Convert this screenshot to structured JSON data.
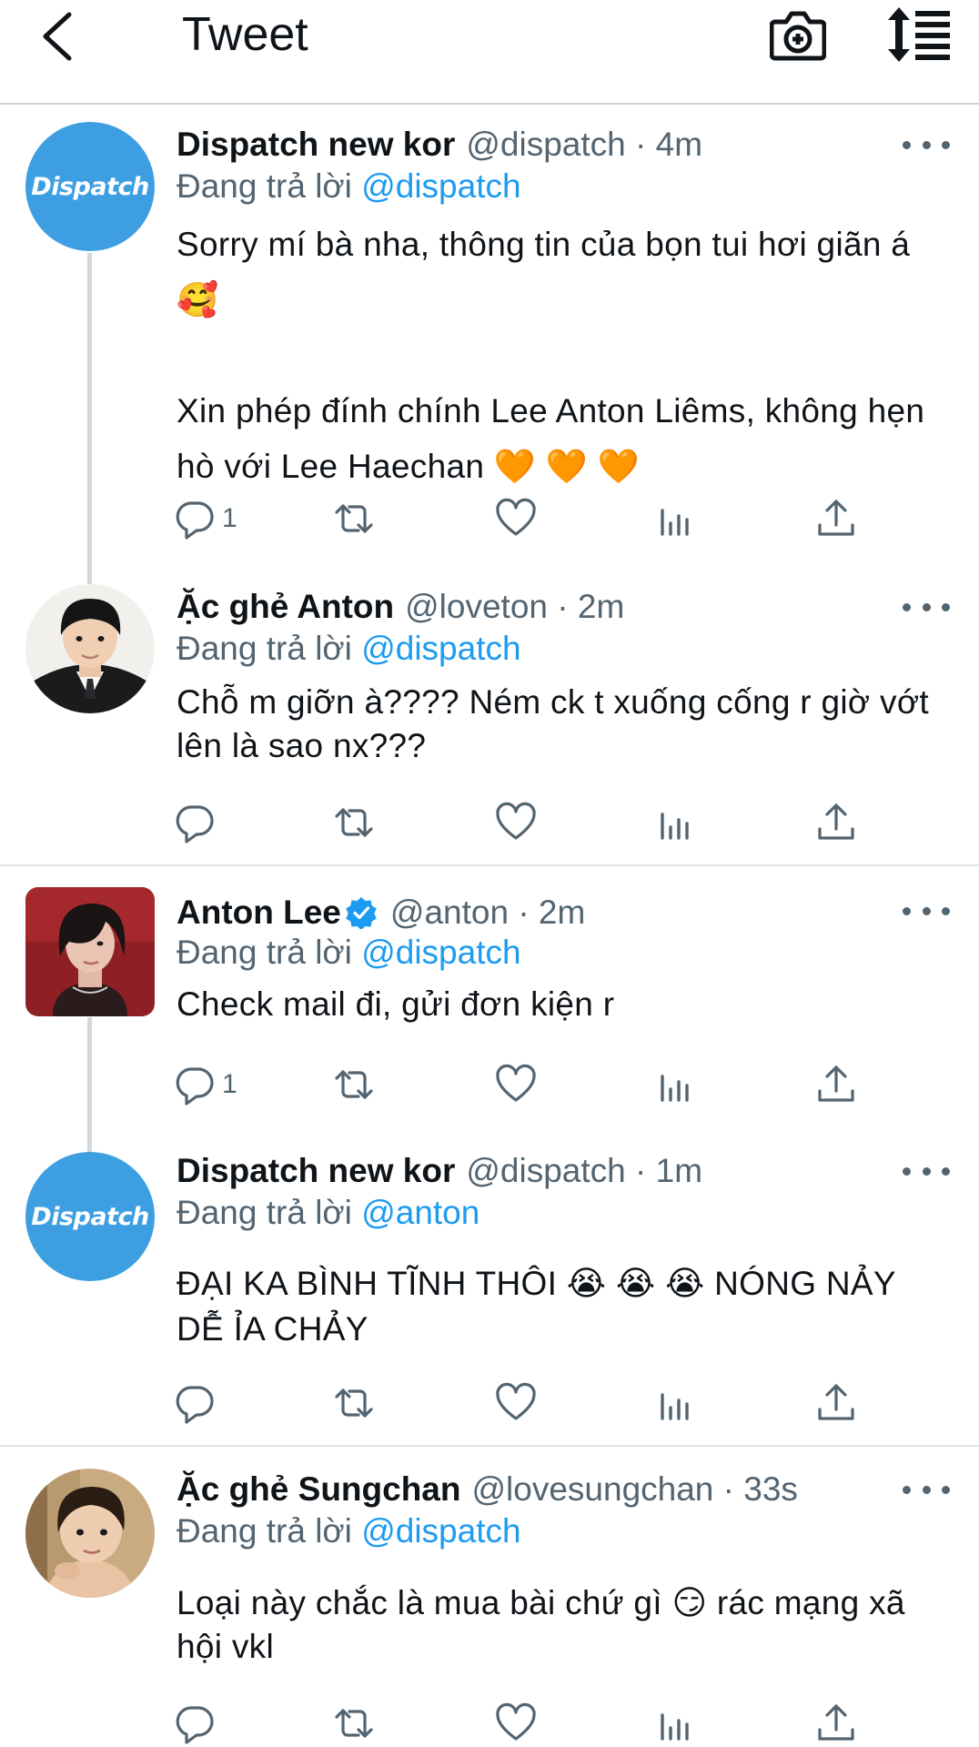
{
  "header": {
    "title": "Tweet"
  },
  "tweets": [
    {
      "name": "Dispatch new kor",
      "handle": "@dispatch · 4m",
      "avatar_text": "Dispatch",
      "reply_prefix": "Đang trả lời",
      "reply_to": "@dispatch",
      "text": "Sorry mí bà nha, thông tin của bọn tui hơi giãn á 🥰\n\nXin phép đính chính Lee Anton Liêms, không hẹn hò với Lee Haechan 🧡 🧡 🧡",
      "reply_count": "1"
    },
    {
      "name": "Ặc ghẻ Anton",
      "handle": "@loveton · 2m",
      "reply_prefix": "Đang trả lời",
      "reply_to": "@dispatch",
      "text": "Chỗ m giỡn à???? Ném ck t xuống cống r giờ vớt lên là sao nx???",
      "reply_count": ""
    },
    {
      "name": "Anton Lee",
      "handle": "@anton · 2m",
      "verified": true,
      "reply_prefix": "Đang trả lời",
      "reply_to": "@dispatch",
      "text": "Check mail đi, gửi đơn kiện r",
      "reply_count": "1"
    },
    {
      "name": "Dispatch new kor",
      "handle": "@dispatch · 1m",
      "avatar_text": "Dispatch",
      "reply_prefix": "Đang trả lời",
      "reply_to": "@anton",
      "text": "ĐẠI KA BÌNH TĨNH THÔI 😭 😭 😭  NÓNG NẢY DỄ ỈA CHẢY",
      "reply_count": ""
    },
    {
      "name": "Ặc ghẻ Sungchan",
      "handle": "@lovesungchan · 33s",
      "reply_prefix": "Đang trả lời",
      "reply_to": "@dispatch",
      "text": "Loại này chắc là mua bài chứ gì 😏  rác mạng xã hội vkl",
      "reply_count": ""
    }
  ],
  "icons": {
    "back": "chevron-left-icon",
    "camera": "camera-add-icon",
    "sort": "sort-icon",
    "reply": "reply-icon",
    "retweet": "retweet-icon",
    "like": "heart-icon",
    "views": "views-icon",
    "share": "share-icon",
    "more": "more-icon"
  },
  "colors": {
    "accent": "#1d9bf0",
    "secondary_text": "#536471",
    "dispatch_avatar": "#3d9fe2",
    "verified": "#1d9bf0"
  }
}
